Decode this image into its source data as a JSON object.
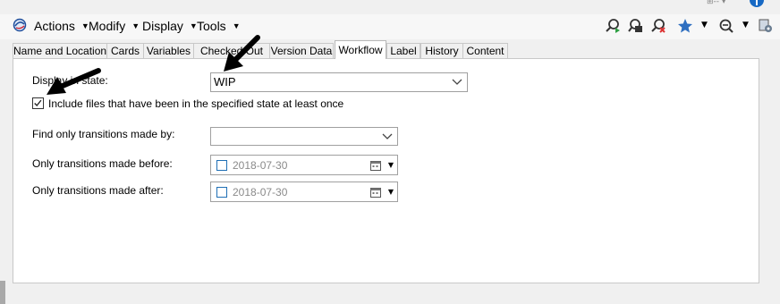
{
  "top_ghost": "⊞-- ▾",
  "help_glyph": "i",
  "menu": {
    "items": [
      {
        "label": "Actions"
      },
      {
        "label": "Modify"
      },
      {
        "label": "Display"
      },
      {
        "label": "Tools"
      }
    ],
    "caret": "▼"
  },
  "toolbar": {
    "icons": [
      "search-green-icon",
      "locked-search-icon",
      "search-remove-icon",
      "favorites-star-icon",
      "zoom-icon",
      "settings-icon"
    ],
    "caret": "▼",
    "accent_star": "#2f6fc0"
  },
  "tabs": [
    {
      "label": "Name and Location",
      "active": false
    },
    {
      "label": "Cards",
      "active": false
    },
    {
      "label": "Variables",
      "active": false
    },
    {
      "label": "Checked Out",
      "active": false
    },
    {
      "label": "Version Data",
      "active": false
    },
    {
      "label": "Workflow",
      "active": true
    },
    {
      "label": "Label",
      "active": false
    },
    {
      "label": "History",
      "active": false
    },
    {
      "label": "Content",
      "active": false
    }
  ],
  "workflow": {
    "state_label": "Display in state:",
    "state_value": "WIP",
    "include_checked": true,
    "include_label": "Include files that have been in the specified state at least once",
    "transitions_by_label": "Find only transitions made by:",
    "transitions_by_value": "",
    "before_label": "Only transitions made before:",
    "before_value": "2018-07-30",
    "after_label": "Only transitions made after:",
    "after_value": "2018-07-30"
  },
  "colors": {
    "annotation_arrow": "#000000",
    "checkbox_border": "#1f6fb5"
  }
}
